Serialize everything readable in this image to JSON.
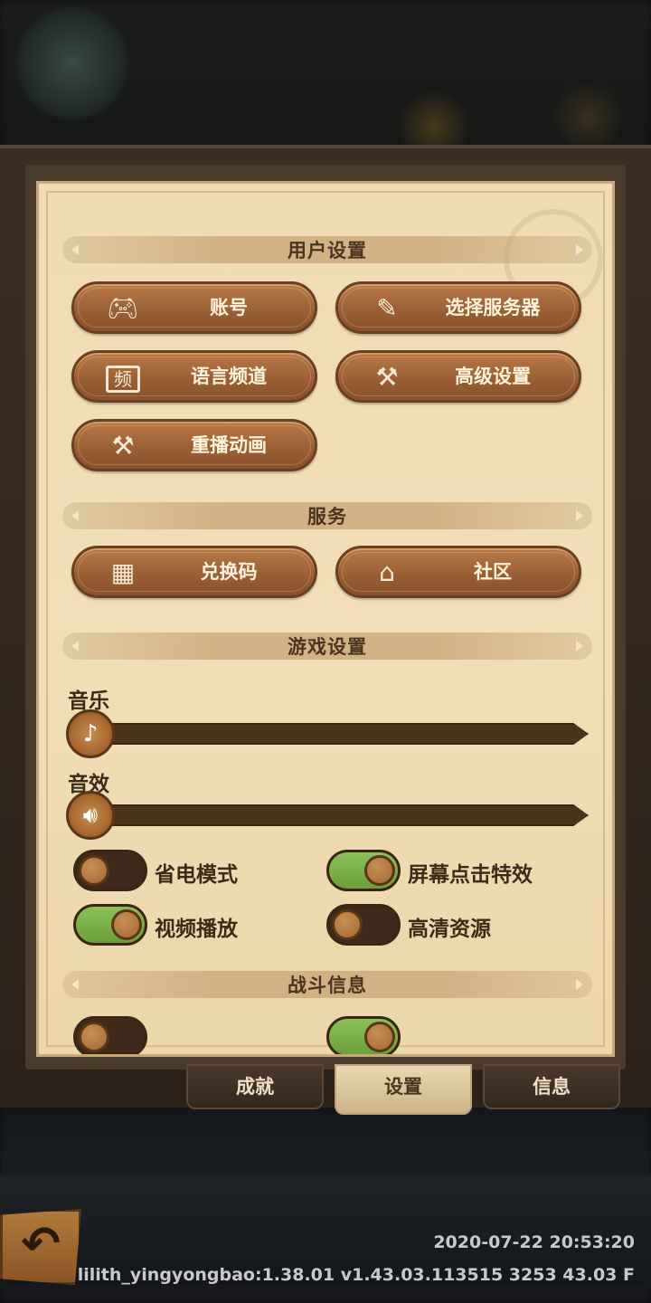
{
  "sections": {
    "user_settings": "用户设置",
    "services": "服务",
    "game_settings": "游戏设置",
    "battle_info": "战斗信息"
  },
  "buttons": {
    "account": {
      "label": "账号",
      "icon": "gamepad-icon"
    },
    "select_server": {
      "label": "选择服务器",
      "icon": "map-quill-icon"
    },
    "language_channel": {
      "label": "语言频道",
      "icon_text": "频"
    },
    "advanced_settings": {
      "label": "高级设置",
      "icon": "tools-icon"
    },
    "replay_animation": {
      "label": "重播动画",
      "icon": "tools-icon"
    },
    "redeem_code": {
      "label": "兑换码",
      "icon": "gift-icon"
    },
    "community": {
      "label": "社区",
      "icon": "home-icon"
    }
  },
  "sliders": {
    "music": {
      "label": "音乐",
      "value": 0
    },
    "sound_effects": {
      "label": "音效",
      "value": 0
    }
  },
  "toggles": [
    {
      "label": "省电模式",
      "on": false
    },
    {
      "label": "屏幕点击特效",
      "on": true
    },
    {
      "label": "视频播放",
      "on": true
    },
    {
      "label": "高清资源",
      "on": false
    }
  ],
  "tabs": [
    {
      "label": "成就",
      "active": false
    },
    {
      "label": "设置",
      "active": true
    },
    {
      "label": "信息",
      "active": false
    }
  ],
  "footer": {
    "timestamp": "2020-07-22 20:53:20",
    "version": "lilith_yingyongbao:1.38.01  v1.43.03.113515 3253 43.03 F"
  }
}
